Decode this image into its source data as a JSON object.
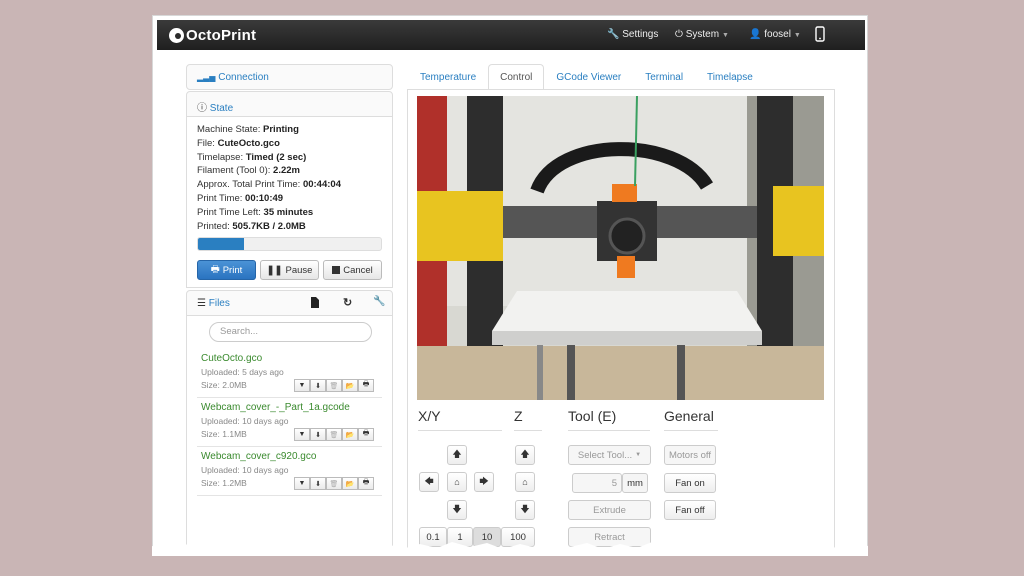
{
  "navbar": {
    "brand": "OctoPrint",
    "settings": "Settings",
    "system": "System",
    "user": "foosel"
  },
  "connection": {
    "title": "Connection"
  },
  "state": {
    "title": "State",
    "lines": [
      {
        "label": "Machine State: ",
        "value": "Printing"
      },
      {
        "label": "File: ",
        "value": "CuteOcto.gco"
      },
      {
        "label": "Timelapse: ",
        "value": "Timed (2 sec)"
      },
      {
        "label": "Filament (Tool 0): ",
        "value": "2.22m"
      },
      {
        "label": "Approx. Total Print Time: ",
        "value": "00:44:04"
      },
      {
        "label": "Print Time: ",
        "value": "00:10:49"
      },
      {
        "label": "Print Time Left: ",
        "value": "35 minutes"
      },
      {
        "label": "Printed: ",
        "value": "505.7KB / 2.0MB"
      }
    ],
    "progress": 0.25,
    "buttons": {
      "print": "Print",
      "pause": "Pause",
      "cancel": "Cancel"
    }
  },
  "files": {
    "title": "Files",
    "search_placeholder": "Search...",
    "items": [
      {
        "name": "CuteOcto.gco",
        "uploaded": "Uploaded: 5 days ago",
        "size": "Size: 2.0MB"
      },
      {
        "name": "Webcam_cover_-_Part_1a.gcode",
        "uploaded": "Uploaded: 10 days ago",
        "size": "Size: 1.1MB"
      },
      {
        "name": "Webcam_cover_c920.gco",
        "uploaded": "Uploaded: 10 days ago",
        "size": "Size: 1.2MB"
      }
    ]
  },
  "tabs": [
    "Temperature",
    "Control",
    "GCode Viewer",
    "Terminal",
    "Timelapse"
  ],
  "active_tab": "Control",
  "control": {
    "xy_title": "X/Y",
    "z_title": "Z",
    "tool_title": "Tool (E)",
    "general_title": "General",
    "select_tool": "Select Tool...",
    "extrude_amount": "5",
    "extrude_unit": "mm",
    "extrude": "Extrude",
    "retract": "Retract",
    "motors_off": "Motors off",
    "fan_on": "Fan on",
    "fan_off": "Fan off",
    "step_sizes": [
      "0.1",
      "1",
      "10",
      "100"
    ],
    "active_step": "10"
  },
  "colors": {
    "accent": "#2a7fc1",
    "file_link": "#3a8a2e",
    "background": "#c9b5b5"
  }
}
